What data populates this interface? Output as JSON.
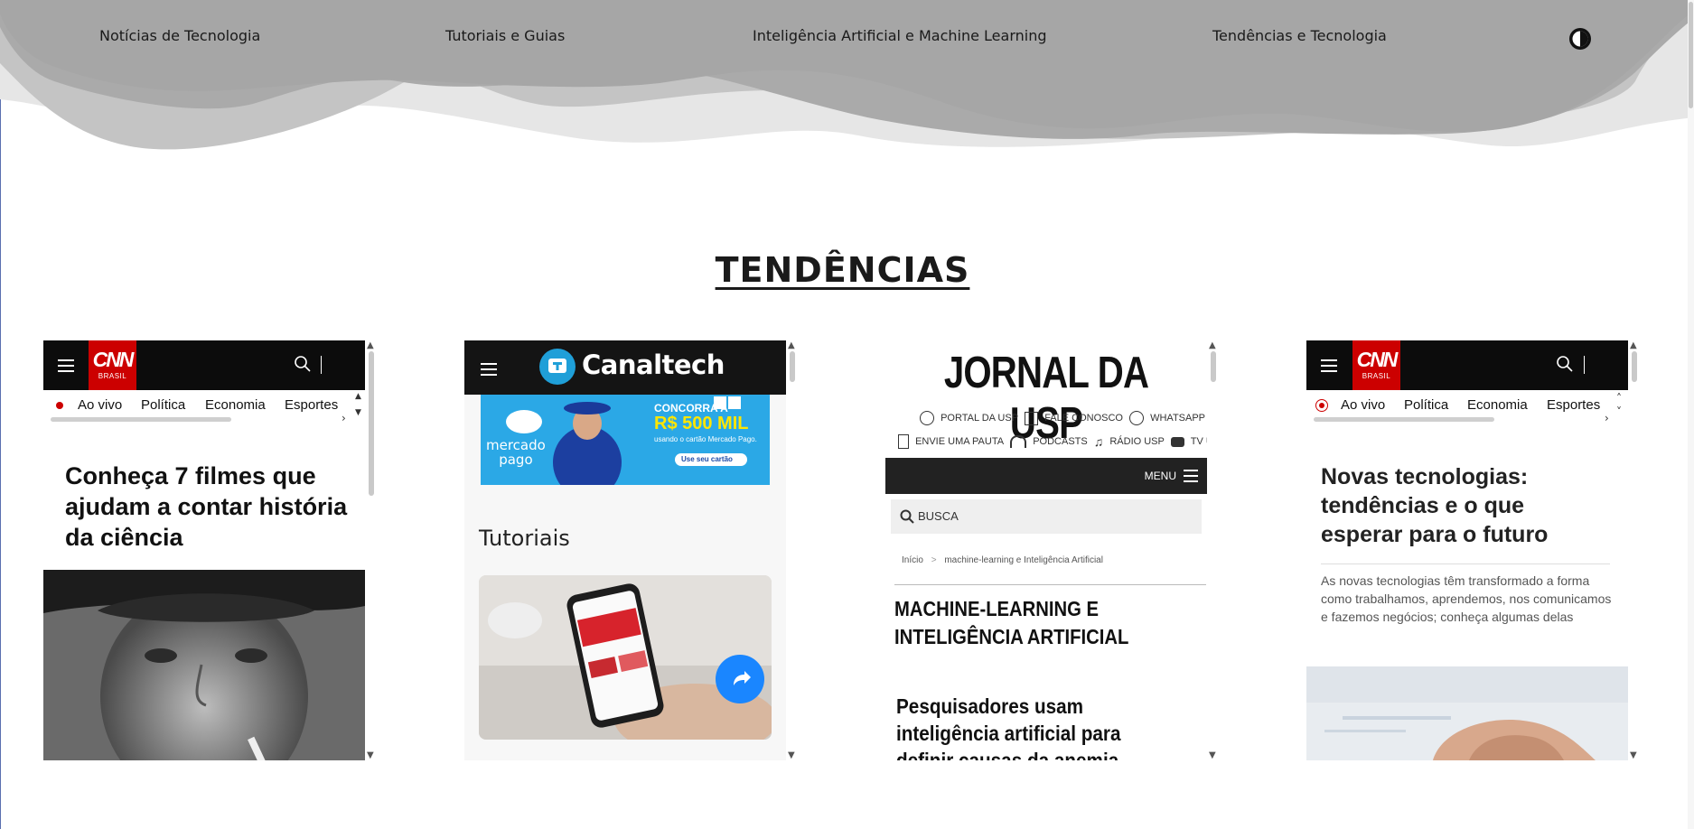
{
  "nav": {
    "items": [
      {
        "label": "Notícias de Tecnologia"
      },
      {
        "label": "Tutoriais e Guias"
      },
      {
        "label": "Inteligência Artificial e Machine Learning"
      },
      {
        "label": "Tendências e Tecnologia"
      }
    ],
    "theme_toggle_icon": "contrast-icon"
  },
  "section": {
    "title": "TENDÊNCIAS"
  },
  "cards": [
    {
      "site": "CNN",
      "logo": {
        "big": "CNN",
        "small": "BRASIL"
      },
      "subnav": [
        "Ao vivo",
        "Política",
        "Economia",
        "Esportes"
      ],
      "headline": "Conheça 7 filmes que ajudam a contar história da ciência"
    },
    {
      "site": "Canaltech",
      "logo_text": "Canaltech",
      "ad": {
        "line1": "CONCORRA A",
        "line2": "R$ 500 MIL",
        "line3": "usando o cartão Mercado Pago.",
        "button": "Use seu cartão",
        "brand_line1": "mercado",
        "brand_line2": "pago"
      },
      "section_label": "Tutoriais"
    },
    {
      "site": "JORNAL DA USP",
      "links_row1": [
        "PORTAL DA USP",
        "FALE CONOSCO",
        "WHATSAPP"
      ],
      "links_row2": [
        "ENVIE UMA PAUTA",
        "PODCASTS",
        "RÁDIO USP",
        "TV USP"
      ],
      "menu_label": "MENU",
      "search_placeholder": "BUSCA",
      "breadcrumb": [
        "Início",
        ">",
        "machine-learning e Inteligência Artificial"
      ],
      "section_title": "MACHINE-LEARNING E INTELIGÊNCIA ARTIFICIAL",
      "article_title": "Pesquisadores usam inteligência artificial para definir causas da anemia"
    },
    {
      "site": "CNN",
      "logo": {
        "big": "CNN",
        "small": "BRASIL"
      },
      "subnav": [
        "Ao vivo",
        "Política",
        "Economia",
        "Esportes"
      ],
      "headline": "Novas tecnologias: tendências e o que esperar para o futuro",
      "description": "As novas tecnologias têm transformado a forma como trabalhamos, aprendemos, nos comunicamos e fazemos negócios; conheça algumas delas"
    }
  ],
  "colors": {
    "wave_dark": "#a8a8a8",
    "wave_light": "#d9d9d9",
    "cnn_red": "#cc0000",
    "canaltech_blue": "#1f9fd8",
    "share_blue": "#1a86ff"
  }
}
